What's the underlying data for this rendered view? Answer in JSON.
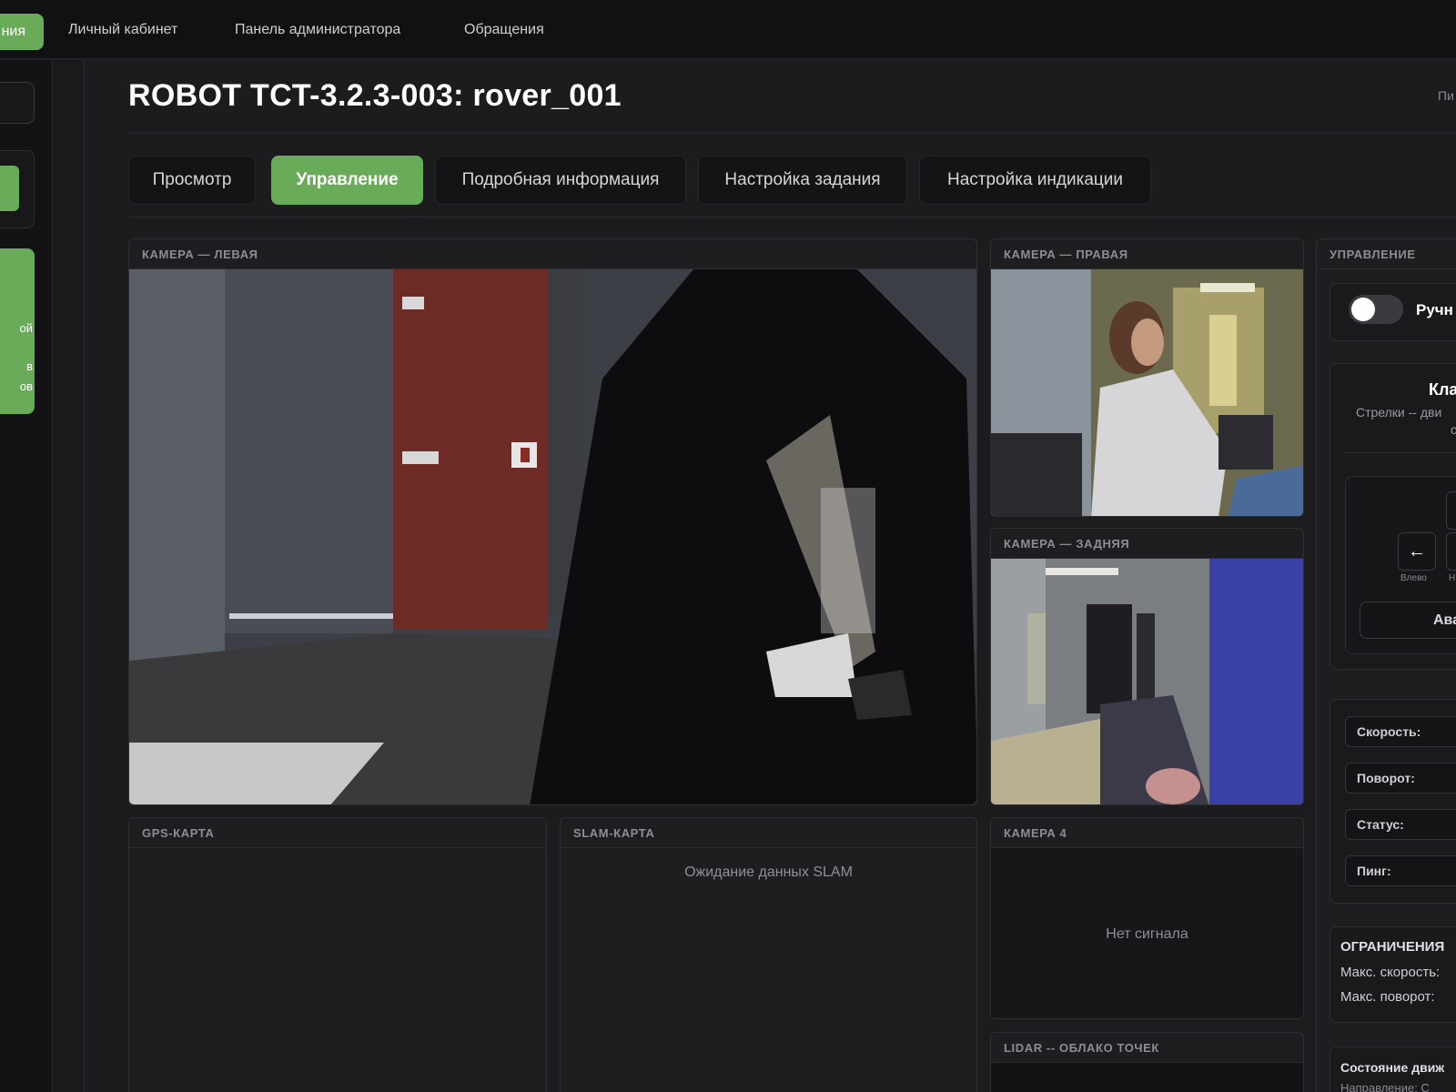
{
  "topnav": {
    "active_label": "ния",
    "items": [
      "Личный кабинет",
      "Панель администратора",
      "Обращения"
    ]
  },
  "sidebar": {
    "green_block_lines": [
      "ой",
      "в",
      "ов"
    ]
  },
  "page": {
    "title": "ROBOT TCT-3.2.3-003: rover_001",
    "right_text": "Пи"
  },
  "tabs": [
    "Просмотр",
    "Управление",
    "Подробная информация",
    "Настройка задания",
    "Настройка индикации"
  ],
  "panels": {
    "cam_left": "КАМЕРА — ЛЕВАЯ",
    "cam_right": "КАМЕРА — ПРАВАЯ",
    "cam_rear": "КАМЕРА — ЗАДНЯЯ",
    "gps": "GPS-КАРТА",
    "slam": "SLAM-КАРТА",
    "slam_status": "Ожидание данных SLAM",
    "cam4": "КАМЕРА 4",
    "cam4_status": "Нет сигнала",
    "lidar": "LIDAR -- ОБЛАКО ТОЧЕК",
    "control": "УПРАВЛЕНИЕ"
  },
  "control": {
    "manual_label": "Ручн",
    "keyboard_title": "Кла",
    "keyboard_hint_line1": "Стрелки -- дви",
    "keyboard_hint_line2": "с",
    "arrow_left": "←",
    "key_caption_left": "Влево",
    "key_caption_mid": "Н",
    "emergency_label": "Ава",
    "stats": [
      "Скорость:",
      "Поворот:",
      "Статус:",
      "Пинг:"
    ],
    "limits_title": "ОГРАНИЧЕНИЯ",
    "max_speed": "Макс. скорость:",
    "max_turn": "Макс. поворот:",
    "motion_state": "Состояние движ",
    "motion_sub": "Направление: С"
  },
  "colors": {
    "accent": "#6aab5a",
    "background": "#1c1c1f",
    "panel": "#1e1e21"
  }
}
